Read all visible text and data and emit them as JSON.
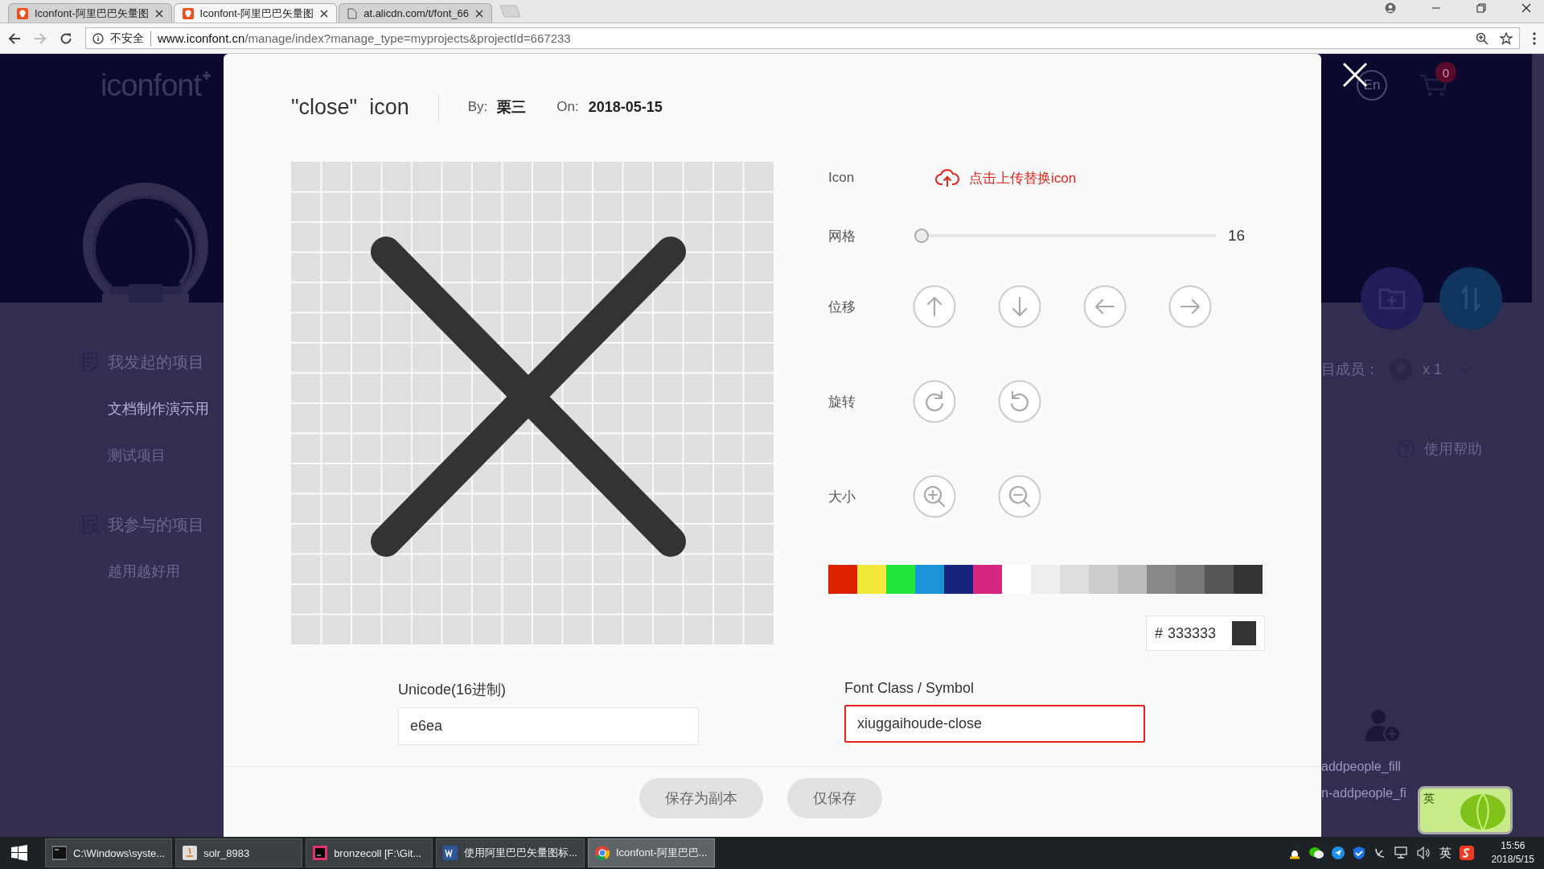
{
  "browser": {
    "tabs": [
      {
        "title": "Iconfont-阿里巴巴矢量图",
        "kind": "site",
        "selected": false
      },
      {
        "title": "Iconfont-阿里巴巴矢量图",
        "kind": "site",
        "selected": true
      },
      {
        "title": "at.alicdn.com/t/font_66",
        "kind": "file",
        "selected": false
      }
    ],
    "security": "不安全",
    "url_host": "www.iconfont.cn",
    "url_path": "/manage/index?manage_type=myprojects&projectId=667233"
  },
  "page": {
    "logo": "iconfont",
    "sidebar": [
      {
        "heading": "我发起的项目",
        "kind": "edit",
        "items": [
          {
            "label": "文档制作演示用",
            "selected": true
          },
          {
            "label": "测试项目",
            "selected": false
          }
        ]
      },
      {
        "heading": "我参与的项目",
        "kind": "person",
        "items": [
          {
            "label": "越用越好用",
            "selected": false
          }
        ]
      }
    ],
    "language": "En",
    "cart_count": "0",
    "members_label": "目成员：",
    "members_count": "x 1",
    "help": "使用帮助",
    "icon_names": [
      "addpeople_fill",
      "n-addpeople_fi"
    ]
  },
  "modal": {
    "title": "\"close\"  icon",
    "by_label": "By:",
    "author": "栗三",
    "on_label": "On:",
    "date": "2018-05-15",
    "icon_label": "Icon",
    "upload": "点击上传替换icon",
    "grid_label": "网格",
    "grid_slider": {
      "level": 0
    },
    "grid_value": "16",
    "move_label": "位移",
    "rotate_label": "旋转",
    "size_label": "大小",
    "palette": [
      {
        "color": "#dd2200"
      },
      {
        "color": "#f1e83a"
      },
      {
        "color": "#1ee63a"
      },
      {
        "color": "#1a93d8"
      },
      {
        "color": "#16237a"
      },
      {
        "color": "#d6267f"
      },
      {
        "color": "#ffffff"
      },
      {
        "color": "#eeeeee"
      },
      {
        "color": "#dddddd"
      },
      {
        "color": "#cccccc"
      },
      {
        "color": "#bbbbbb"
      },
      {
        "color": "#888888"
      },
      {
        "color": "#777777"
      },
      {
        "color": "#555555"
      },
      {
        "color": "#333333"
      }
    ],
    "hex_prefix": "#",
    "hex_value": "333333",
    "unicode_label": "Unicode(16进制)",
    "unicode_value": "e6ea",
    "font_class_label": "Font Class / Symbol",
    "font_class_value": "xiuggaihoude-close",
    "font_class_focused": true,
    "buttons": [
      "保存为副本",
      "仅保存"
    ]
  },
  "taskbar": {
    "items": [
      {
        "label": "C:\\Windows\\syste...",
        "kind": "console",
        "selected": false
      },
      {
        "label": "solr_8983",
        "kind": "java",
        "selected": false
      },
      {
        "label": "bronzecoll [F:\\Git...",
        "kind": "ide",
        "selected": false
      },
      {
        "label": "使用阿里巴巴矢量图标...",
        "kind": "word",
        "selected": false
      },
      {
        "label": "Iconfont-阿里巴巴...",
        "kind": "chrome",
        "selected": true
      }
    ],
    "tray_lang": "英",
    "time": "15:56",
    "date": "2018/5/15",
    "ime_widget": "英"
  }
}
